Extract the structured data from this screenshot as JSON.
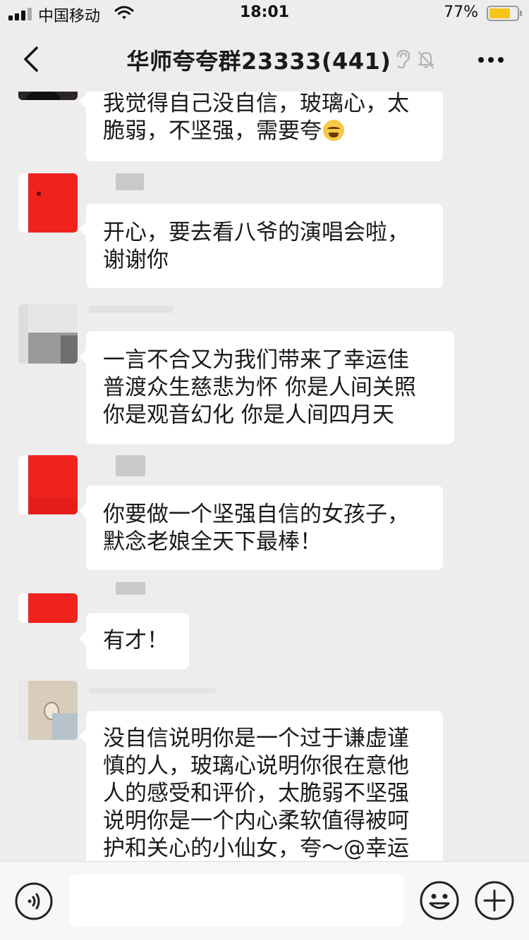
{
  "status_bar": {
    "carrier": "中国移动",
    "time": "18:01",
    "battery_percent_text": "77%",
    "battery_level": 0.77,
    "signal_icon": "cellular-signal-icon",
    "wifi_icon": "wifi-icon"
  },
  "nav": {
    "title": "华师夸夸群23333(441)",
    "back_icon": "chevron-left-icon",
    "ear_icon": "ear-icon",
    "mute_icon": "bell-off-icon",
    "more_icon": "more-horizontal-icon"
  },
  "messages": [
    {
      "lines": [
        "我觉得自己没自信，玻璃心，太",
        "脆弱，不坚强，需要夸"
      ],
      "emoji": "crying-laughing-emoji",
      "avatar_color": "#2b2523"
    },
    {
      "lines": [
        "开心，要去看八爷的演唱会啦，",
        "谢谢你"
      ],
      "avatar_color": "#f0221e"
    },
    {
      "lines": [
        "一言不合又为我们带来了幸运佳",
        "普渡众生慈悲为怀 你是人间关照",
        "你是观音幻化 你是人间四月天"
      ],
      "avatar_color": "#8a8a8a"
    },
    {
      "lines": [
        "你要做一个坚强自信的女孩子，",
        "默念老娘全天下最棒！"
      ],
      "avatar_color": "#f0221e"
    },
    {
      "lines": [
        "有才！"
      ],
      "avatar_color": "#f0221e"
    },
    {
      "lines": [
        "没自信说明你是一个过于谦虚谨",
        "慎的人，玻璃心说明你很在意他",
        "人的感受和评价，太脆弱不坚强",
        "说明你是一个内心柔软值得被呵",
        "护和关心的小仙女，夸～@幸运"
      ],
      "avatar_color": "#d8cdbd"
    }
  ],
  "input_bar": {
    "voice_icon": "voice-icon",
    "input_value": "",
    "emoji_icon": "emoji-smile-icon",
    "plus_icon": "plus-circle-icon"
  },
  "colors": {
    "background": "#ededed",
    "bubble": "#ffffff",
    "text": "#1a1a1a",
    "battery": "#f5c518"
  }
}
